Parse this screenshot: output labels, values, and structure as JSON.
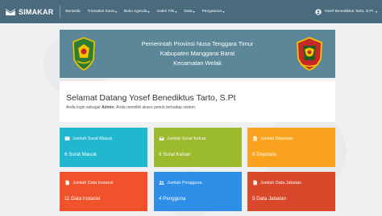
{
  "app": {
    "title": "SIMAKAR"
  },
  "nav": {
    "items": [
      {
        "label": "Beranda",
        "has_caret": false
      },
      {
        "label": "Transaksi Surat",
        "has_caret": true
      },
      {
        "label": "Buku Agenda",
        "has_caret": true
      },
      {
        "label": "Galeri File",
        "has_caret": true
      },
      {
        "label": "Data",
        "has_caret": true
      },
      {
        "label": "Pengaturan",
        "has_caret": true
      }
    ],
    "user": "Yosef Benediktus Tarto, S.Pt"
  },
  "banner": {
    "line1": "Pemerintah Provinsi Nusa Tenggara Timur",
    "line2": "Kabupaten Manggarai Barat",
    "line3": "Kecamatan Welak"
  },
  "welcome": {
    "title": "Selamat Datang Yosef Benediktus Tarto, S.Pt",
    "sub_prefix": "Anda login sebagai",
    "role": "Admin",
    "sub_suffix": ". Anda memiliki akses penuh terhadap sistem."
  },
  "cards": [
    {
      "title": "Jumlah Surat Masuk",
      "value": "6 Surat Masuk",
      "icon": "mail-icon",
      "color": "#21b8cf"
    },
    {
      "title": "Jumlah Surat Keluar",
      "value": "9 Surat Keluar",
      "icon": "drafts-icon",
      "color": "#9bbb2c"
    },
    {
      "title": "Jumlah Disposisi",
      "value": "6 Disposisi",
      "icon": "description-icon",
      "color": "#f9a21d"
    },
    {
      "title": "Jumlah Data Instansi",
      "value": "11 Data Instansi",
      "icon": "document-icon",
      "color": "#f0532c"
    },
    {
      "title": "Jumlah Pengguna",
      "value": "4 Pengguna",
      "icon": "people-icon",
      "color": "#2f8ee8"
    },
    {
      "title": "Jumlah Data Jabatan",
      "value": "5 Data Jabatan",
      "icon": "document-icon",
      "color": "#d9482a"
    }
  ]
}
